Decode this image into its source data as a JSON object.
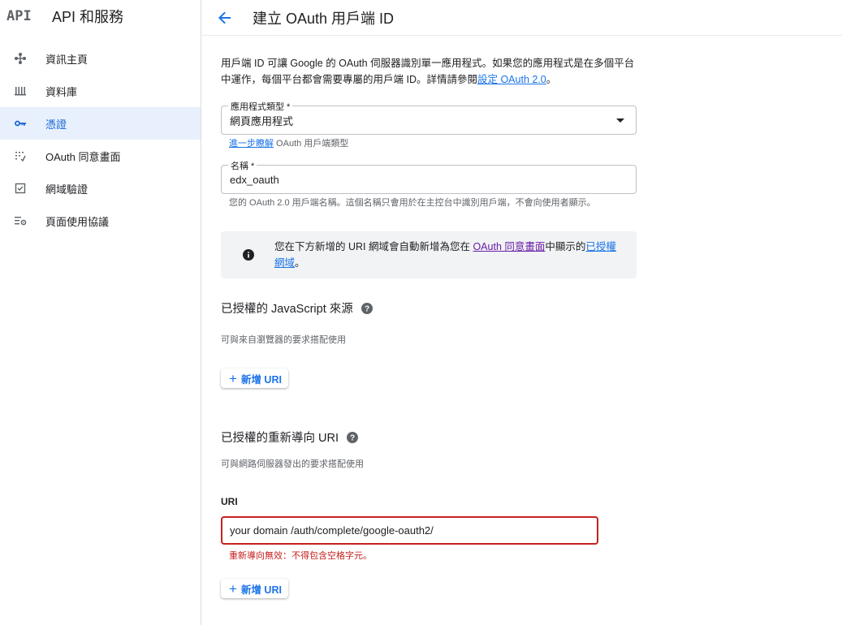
{
  "app": {
    "logo": "API",
    "title": "API 和服務"
  },
  "sidebar": {
    "items": [
      {
        "label": "資訊主頁",
        "icon": "dashboard-icon",
        "active": false
      },
      {
        "label": "資料庫",
        "icon": "library-icon",
        "active": false
      },
      {
        "label": "憑證",
        "icon": "key-icon",
        "active": true
      },
      {
        "label": "OAuth 同意畫面",
        "icon": "consent-icon",
        "active": false
      },
      {
        "label": "網域驗證",
        "icon": "checkbox-icon",
        "active": false
      },
      {
        "label": "頁面使用協議",
        "icon": "settings-list-icon",
        "active": false
      }
    ]
  },
  "header": {
    "title": "建立 OAuth 用戶端 ID"
  },
  "intro": {
    "text": "用戶端 ID 可讓 Google 的 OAuth 伺服器識別單一應用程式。如果您的應用程式是在多個平台中運作，每個平台都會需要專屬的用戶端 ID。詳情請參閱",
    "link": "設定 OAuth 2.0",
    "end": "。"
  },
  "app_type": {
    "label": "應用程式類型 *",
    "value": "網頁應用程式",
    "hint_link": "進一步瞭解",
    "hint_text": " OAuth 用戶端類型"
  },
  "name_field": {
    "label": "名稱 *",
    "value": "edx_oauth",
    "hint": "您的 OAuth 2.0 用戶端名稱。這個名稱只會用於在主控台中識別用戶端，不會向使用者顯示。"
  },
  "info": {
    "text1": "您在下方新增的 URI 網域會自動新增為您在 ",
    "link1": "OAuth 同意畫面",
    "text2": "中顯示的",
    "link2": "已授權網域",
    "text3": "。"
  },
  "js_origins": {
    "title": "已授權的 JavaScript 來源",
    "subtitle": "可與來自瀏覽器的要求搭配使用",
    "add_label": "新增 URI"
  },
  "redirect": {
    "title": "已授權的重新導向 URI",
    "subtitle": "可與網路伺服器發出的要求搭配使用",
    "uri_label": "URI",
    "uri_value": "your domain /auth/complete/google-oauth2/",
    "error": "重新導向無效：不得包含空格字元。",
    "add_label": "新增 URI"
  },
  "colors": {
    "primary": "#1a73e8",
    "error": "#c5221f",
    "active_bg": "#e8f0fe"
  }
}
